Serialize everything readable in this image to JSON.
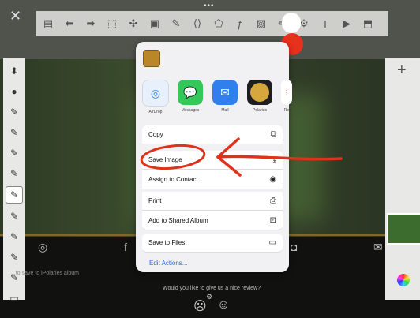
{
  "canvas_toolbar": {
    "tools": [
      "document-icon",
      "undo-icon",
      "redo-icon",
      "select-icon",
      "move-icon",
      "layers-icon",
      "fill-icon",
      "transform-icon",
      "shape-icon",
      "ruler-icon",
      "image-icon",
      "brush-icon",
      "settings-icon",
      "text-icon",
      "video-icon",
      "reference-icon"
    ],
    "text_tool_label": "T"
  },
  "brushes": [
    "pencil",
    "ink",
    "brush1",
    "brush2",
    "brush3",
    "brush4",
    "brush5",
    "brush6",
    "brush7",
    "brush8",
    "brush9",
    "eraser"
  ],
  "share_sheet": {
    "apps": [
      {
        "label": "AirDrop",
        "color": "#e8f1fb",
        "icon": "airdrop-icon",
        "glyph": "⟟"
      },
      {
        "label": "Messages",
        "color": "#34c759",
        "icon": "messages-icon",
        "glyph": "💬"
      },
      {
        "label": "Mail",
        "color": "#2f80ed",
        "icon": "mail-icon",
        "glyph": "✉"
      },
      {
        "label": "Polaries",
        "color": "#d6a73c",
        "icon": "polaries-icon",
        "glyph": "●"
      },
      {
        "label": "Re",
        "color": "#f1f1f3",
        "icon": "reminders-icon",
        "glyph": "⋮"
      }
    ],
    "actions": [
      {
        "label": "Copy",
        "icon": "copy-icon",
        "glyph": "⧉"
      },
      {
        "label": "Save Image",
        "icon": "save-image-icon",
        "glyph": "⤓"
      },
      {
        "label": "Assign to Contact",
        "icon": "contact-icon",
        "glyph": "◉"
      },
      {
        "label": "Print",
        "icon": "print-icon",
        "glyph": "⎙"
      },
      {
        "label": "Add to Shared Album",
        "icon": "shared-album-icon",
        "glyph": "⊡"
      },
      {
        "label": "Save to Files",
        "icon": "folder-icon",
        "glyph": "▭"
      }
    ],
    "edit_actions": "Edit Actions..."
  },
  "status": {
    "save_message": "...to save to iPolaries album",
    "review_question": "Would you like to give us a nice review?"
  },
  "right_panel": {
    "add_label": "+"
  },
  "close_label": "✕",
  "colors": {
    "accent_red": "#e8311c",
    "annotation_red": "#e0321a"
  }
}
